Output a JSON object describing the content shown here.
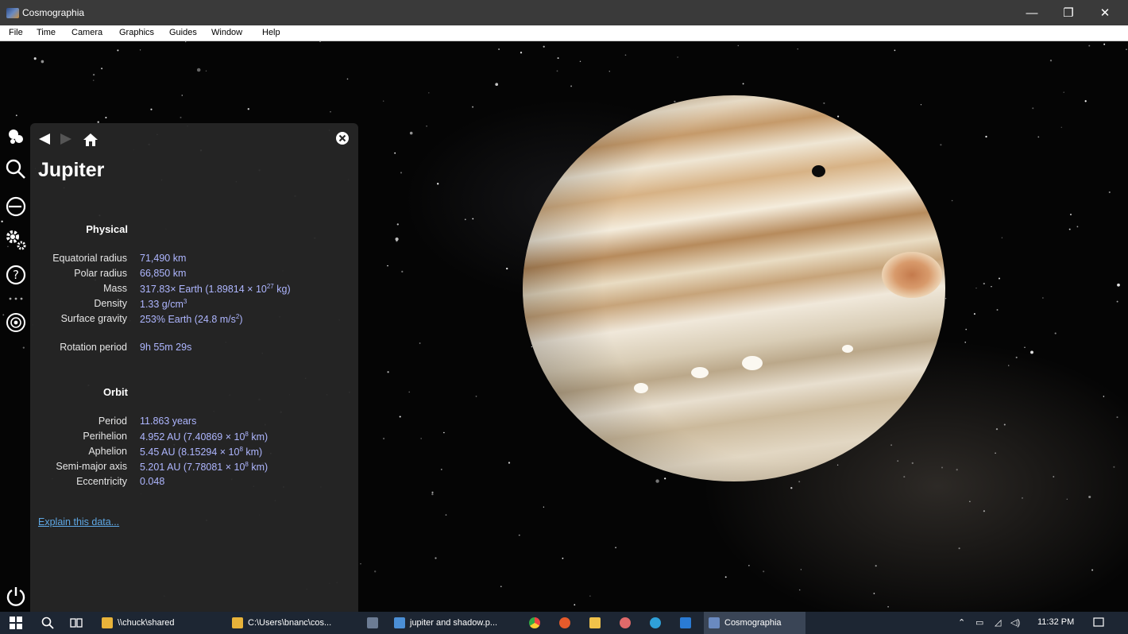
{
  "window": {
    "title": "Cosmographia",
    "min_glyph": "—",
    "max_glyph": "❐",
    "close_glyph": "✕"
  },
  "menu": [
    "File",
    "Time",
    "Camera",
    "Graphics",
    "Guides",
    "Window",
    "Help"
  ],
  "toolbar_icons": [
    "bodies-icon",
    "search-icon",
    "clock-icon",
    "settings-icon",
    "help-icon",
    "more-icon",
    "target-icon",
    "power-icon"
  ],
  "panel": {
    "name": "Jupiter",
    "physical_heading": "Physical",
    "physical": [
      {
        "label": "Equatorial radius",
        "value": "71,490 km"
      },
      {
        "label": "Polar radius",
        "value": "66,850 km"
      },
      {
        "label": "Mass",
        "value": "317.83× Earth (1.89814 × 10",
        "sup": "27",
        "tail": " kg)"
      },
      {
        "label": "Density",
        "value": "1.33 g/cm",
        "sup": "3",
        "tail": ""
      },
      {
        "label": "Surface gravity",
        "value": "253% Earth (24.8 m/s",
        "sup": "2",
        "tail": ")"
      }
    ],
    "rotation": {
      "label": "Rotation period",
      "value": "9h 55m 29s"
    },
    "orbit_heading": "Orbit",
    "orbit": [
      {
        "label": "Period",
        "value": "11.863 years",
        "sup": "",
        "tail": ""
      },
      {
        "label": "Perihelion",
        "value": "4.952 AU (7.40869 × 10",
        "sup": "8",
        "tail": " km)"
      },
      {
        "label": "Aphelion",
        "value": "5.45 AU (8.15294 × 10",
        "sup": "8",
        "tail": " km)"
      },
      {
        "label": "Semi-major axis",
        "value": "5.201 AU (7.78081 × 10",
        "sup": "8",
        "tail": " km)"
      },
      {
        "label": "Eccentricity",
        "value": "0.048",
        "sup": "",
        "tail": ""
      }
    ],
    "explain_link": "Explain this data..."
  },
  "taskbar": {
    "items": [
      {
        "label": "\\\\chuck\\shared",
        "icon": "folder-icon",
        "color": "#e8b33a"
      },
      {
        "label": "C:\\Users\\bnanc\\cos...",
        "icon": "folder-icon",
        "color": "#e8b33a"
      },
      {
        "label": "jupiter and shadow.p...",
        "icon": "image-viewer-icon",
        "color": "#4b8fd6"
      },
      {
        "label": "Cosmographia",
        "icon": "cosmographia-icon",
        "color": "#6a8ac0"
      }
    ],
    "clock": "11:32 PM"
  },
  "colors": {
    "panel_bg": "#262626",
    "value_text": "#aeb6ff",
    "link": "#5ea7e4",
    "taskbar_bg": "#1d2633"
  }
}
